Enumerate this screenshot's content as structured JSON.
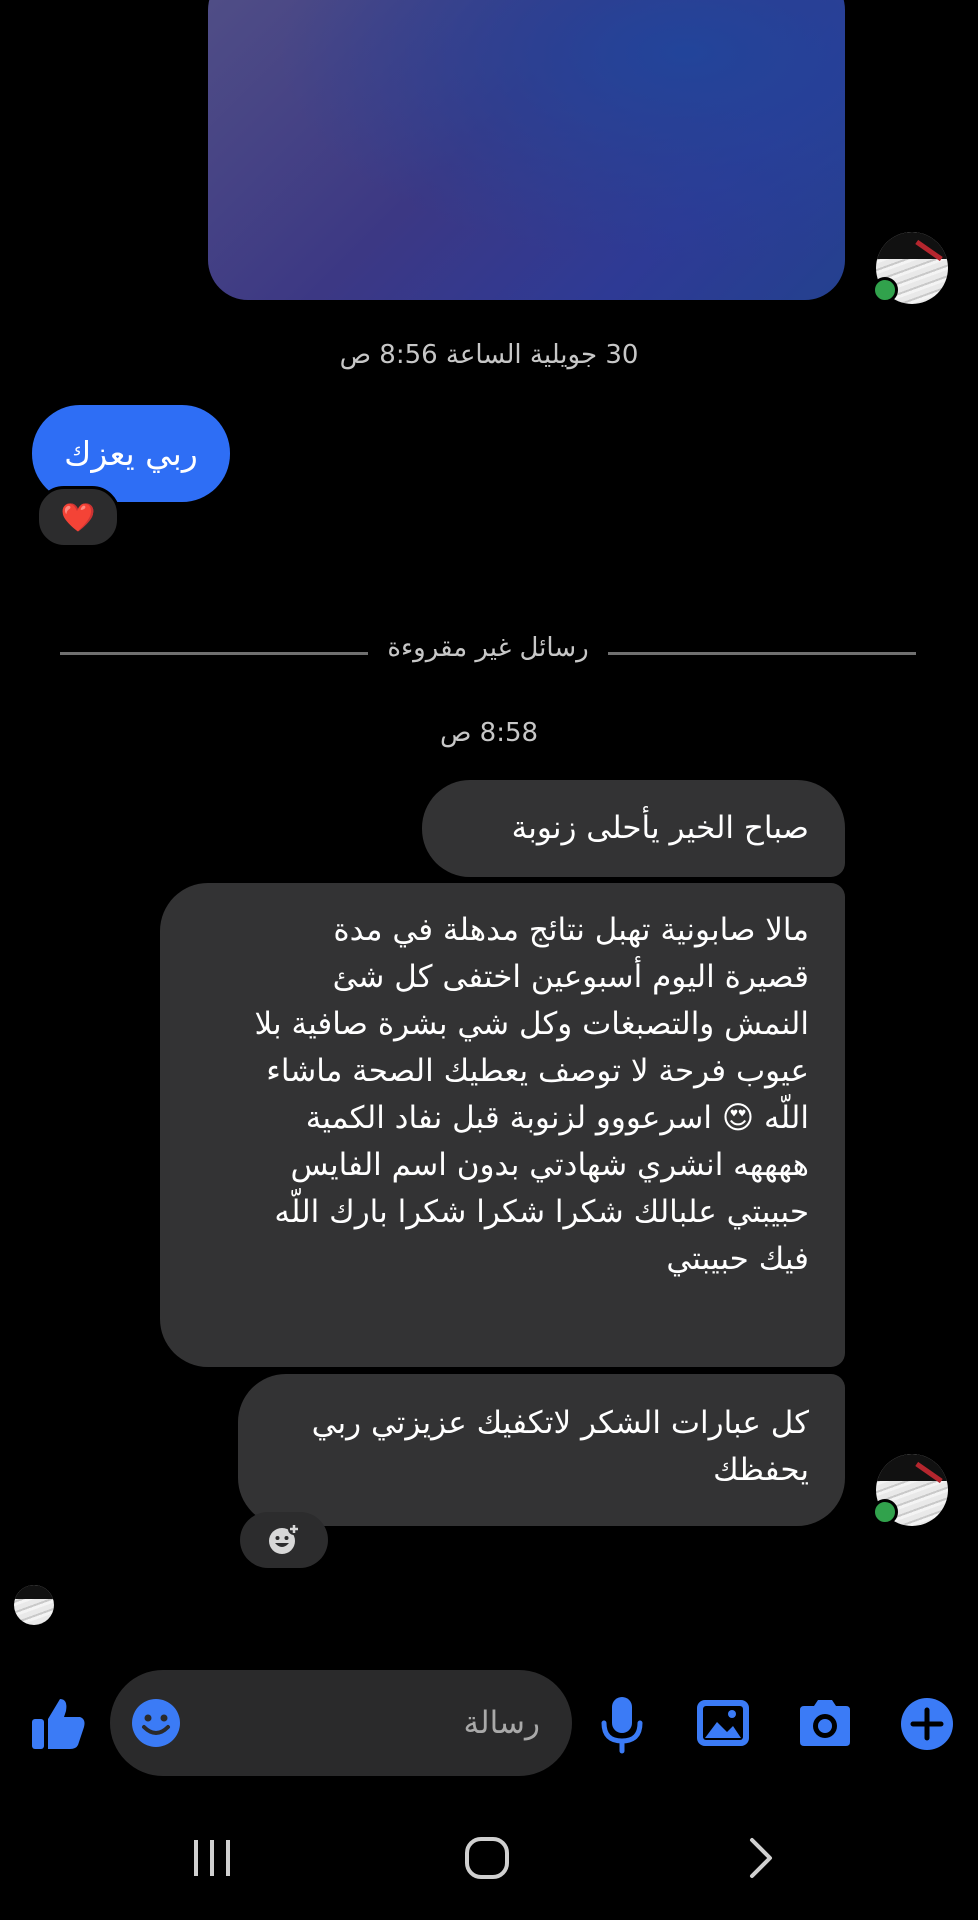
{
  "conversation": {
    "date_stamp": "30 جويلية الساعة 8:56 ص",
    "blue_message": "ربي يعزك",
    "blue_reaction": "❤️",
    "unread_divider": "رسائل غير مقروءة",
    "time_stamp": "8:58 ص",
    "messages": [
      {
        "text": "صباح الخير يأحلى زنوبة"
      },
      {
        "lines": [
          "مالا صابونية تهبل نتائج مدهلة في مدة",
          "قصيرة اليوم أسبوعين اختفى كل شئ",
          "النمش والتصبغات وكل شي بشرة صافية بلا",
          "عيوب فرحة لا توصف يعطيك الصحة ماشاء",
          "اللّه 😍 اسرعووو لزنوبة قبل نفاد الكمية",
          "ههههه انشري شهادتي بدون اسم الفايس",
          "حبيبتي علبالك شكرا شكرا شكرا بارك اللّه",
          "فيك حبيبتي"
        ]
      },
      {
        "lines": [
          "كل عبارات الشكر لاتكفيك عزيزتي ربي",
          "يحفظك"
        ]
      }
    ]
  },
  "composer": {
    "placeholder": "رسالة",
    "icons": [
      "like-icon",
      "emoji-icon",
      "microphone-icon",
      "gallery-icon",
      "camera-icon",
      "plus-icon"
    ],
    "accent_color": "#3b7bf6"
  },
  "system_nav": [
    "recent-apps-icon",
    "home-icon",
    "back-icon"
  ]
}
